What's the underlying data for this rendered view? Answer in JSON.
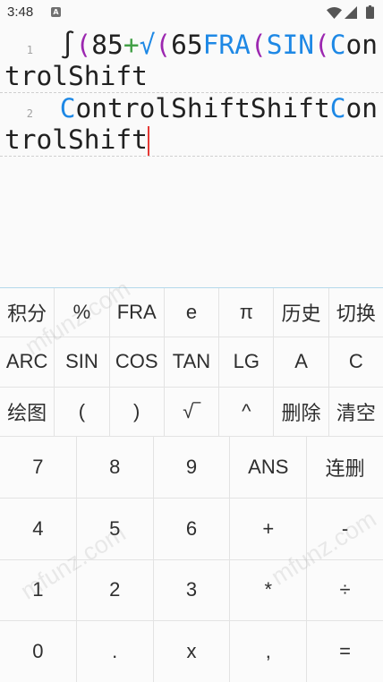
{
  "status_bar": {
    "time": "3:48",
    "notification_badge": "A",
    "icons": [
      "wifi-icon",
      "cellular-signal-icon",
      "battery-icon"
    ]
  },
  "editor": {
    "cursor_color": "#e53935",
    "lines": [
      {
        "number": "1",
        "has_cursor": false,
        "tokens": [
          {
            "text": "∫",
            "color": "#212121"
          },
          {
            "text": "(",
            "color": "#9c27b0"
          },
          {
            "text": "85",
            "color": "#212121"
          },
          {
            "text": "+",
            "color": "#43a047"
          },
          {
            "text": "√",
            "color": "#1e88e5"
          },
          {
            "text": "(",
            "color": "#9c27b0"
          },
          {
            "text": "65",
            "color": "#212121"
          },
          {
            "text": "FRA",
            "color": "#1e88e5"
          },
          {
            "text": "(",
            "color": "#9c27b0"
          },
          {
            "text": "SIN",
            "color": "#1e88e5"
          },
          {
            "text": "(",
            "color": "#9c27b0"
          },
          {
            "text": "C",
            "color": "#1e88e5"
          },
          {
            "text": "ontrolShift",
            "color": "#212121"
          }
        ]
      },
      {
        "number": "2",
        "has_cursor": true,
        "tokens": [
          {
            "text": "C",
            "color": "#1e88e5"
          },
          {
            "text": "ontrolShiftShift",
            "color": "#212121"
          },
          {
            "text": "C",
            "color": "#1e88e5"
          },
          {
            "text": "ontrolShift",
            "color": "#212121"
          }
        ]
      }
    ]
  },
  "keypad": {
    "function_keys": [
      [
        "积分",
        "%",
        "FRA",
        "e",
        "π",
        "历史",
        "切换"
      ],
      [
        "ARC",
        "SIN",
        "COS",
        "TAN",
        "LG",
        "A",
        "C"
      ],
      [
        "绘图",
        "(",
        ")",
        "√‾",
        "^",
        "删除",
        "清空"
      ]
    ],
    "number_keys": [
      [
        "7",
        "8",
        "9",
        "ANS",
        "连删"
      ],
      [
        "4",
        "5",
        "6",
        "+",
        "-"
      ],
      [
        "1",
        "2",
        "3",
        "*",
        "÷"
      ],
      [
        "0",
        ".",
        "x",
        ",",
        "="
      ]
    ]
  },
  "watermark": "mfunz.com"
}
